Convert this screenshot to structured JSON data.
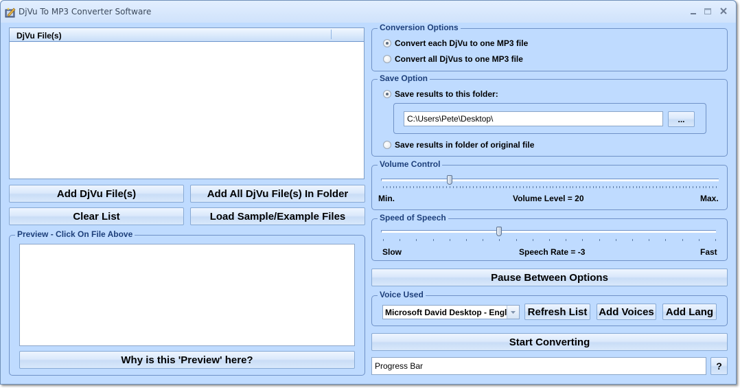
{
  "window": {
    "title": "DjVu To MP3 Converter Software",
    "icons": {
      "app": "app-icon",
      "minimize": "minimize-icon",
      "maximize": "maximize-icon",
      "close": "close-icon"
    }
  },
  "file_list": {
    "columns": [
      "DjVu File(s)"
    ],
    "rows": []
  },
  "file_buttons": {
    "add_files": "Add DjVu File(s)",
    "add_folder": "Add All DjVu File(s) In Folder",
    "clear_list": "Clear List",
    "load_samples": "Load Sample/Example Files"
  },
  "preview": {
    "title": "Preview - Click On File Above",
    "content": "",
    "why_button": "Why is this 'Preview' here?"
  },
  "conversion_options": {
    "title": "Conversion Options",
    "options": [
      {
        "label": "Convert each DjVu to one MP3 file",
        "checked": true
      },
      {
        "label": "Convert all DjVus to one MP3 file",
        "checked": false
      }
    ]
  },
  "save_option": {
    "title": "Save Option",
    "to_folder_label": "Save results to this folder:",
    "to_folder_checked": true,
    "folder_path": "C:\\Users\\Pete\\Desktop\\",
    "browse_button": "...",
    "original_folder_label": "Save results in folder of original file",
    "original_folder_checked": false
  },
  "volume": {
    "title": "Volume Control",
    "min_label": "Min.",
    "max_label": "Max.",
    "value_text": "Volume Level = 20",
    "value": 20,
    "min": 0,
    "max": 100
  },
  "speech": {
    "title": "Speed of Speech",
    "min_label": "Slow",
    "max_label": "Fast",
    "value_text": "Speech Rate = -3",
    "value": -3,
    "min": -10,
    "max": 10
  },
  "pause_button": "Pause Between Options",
  "voice": {
    "title": "Voice Used",
    "selected": "Microsoft David Desktop - Engli",
    "refresh_button": "Refresh List",
    "add_voices_button": "Add Voices",
    "add_lang_button": "Add Lang"
  },
  "start_button": "Start Converting",
  "progress": {
    "text": "Progress Bar",
    "help_button": "?"
  }
}
